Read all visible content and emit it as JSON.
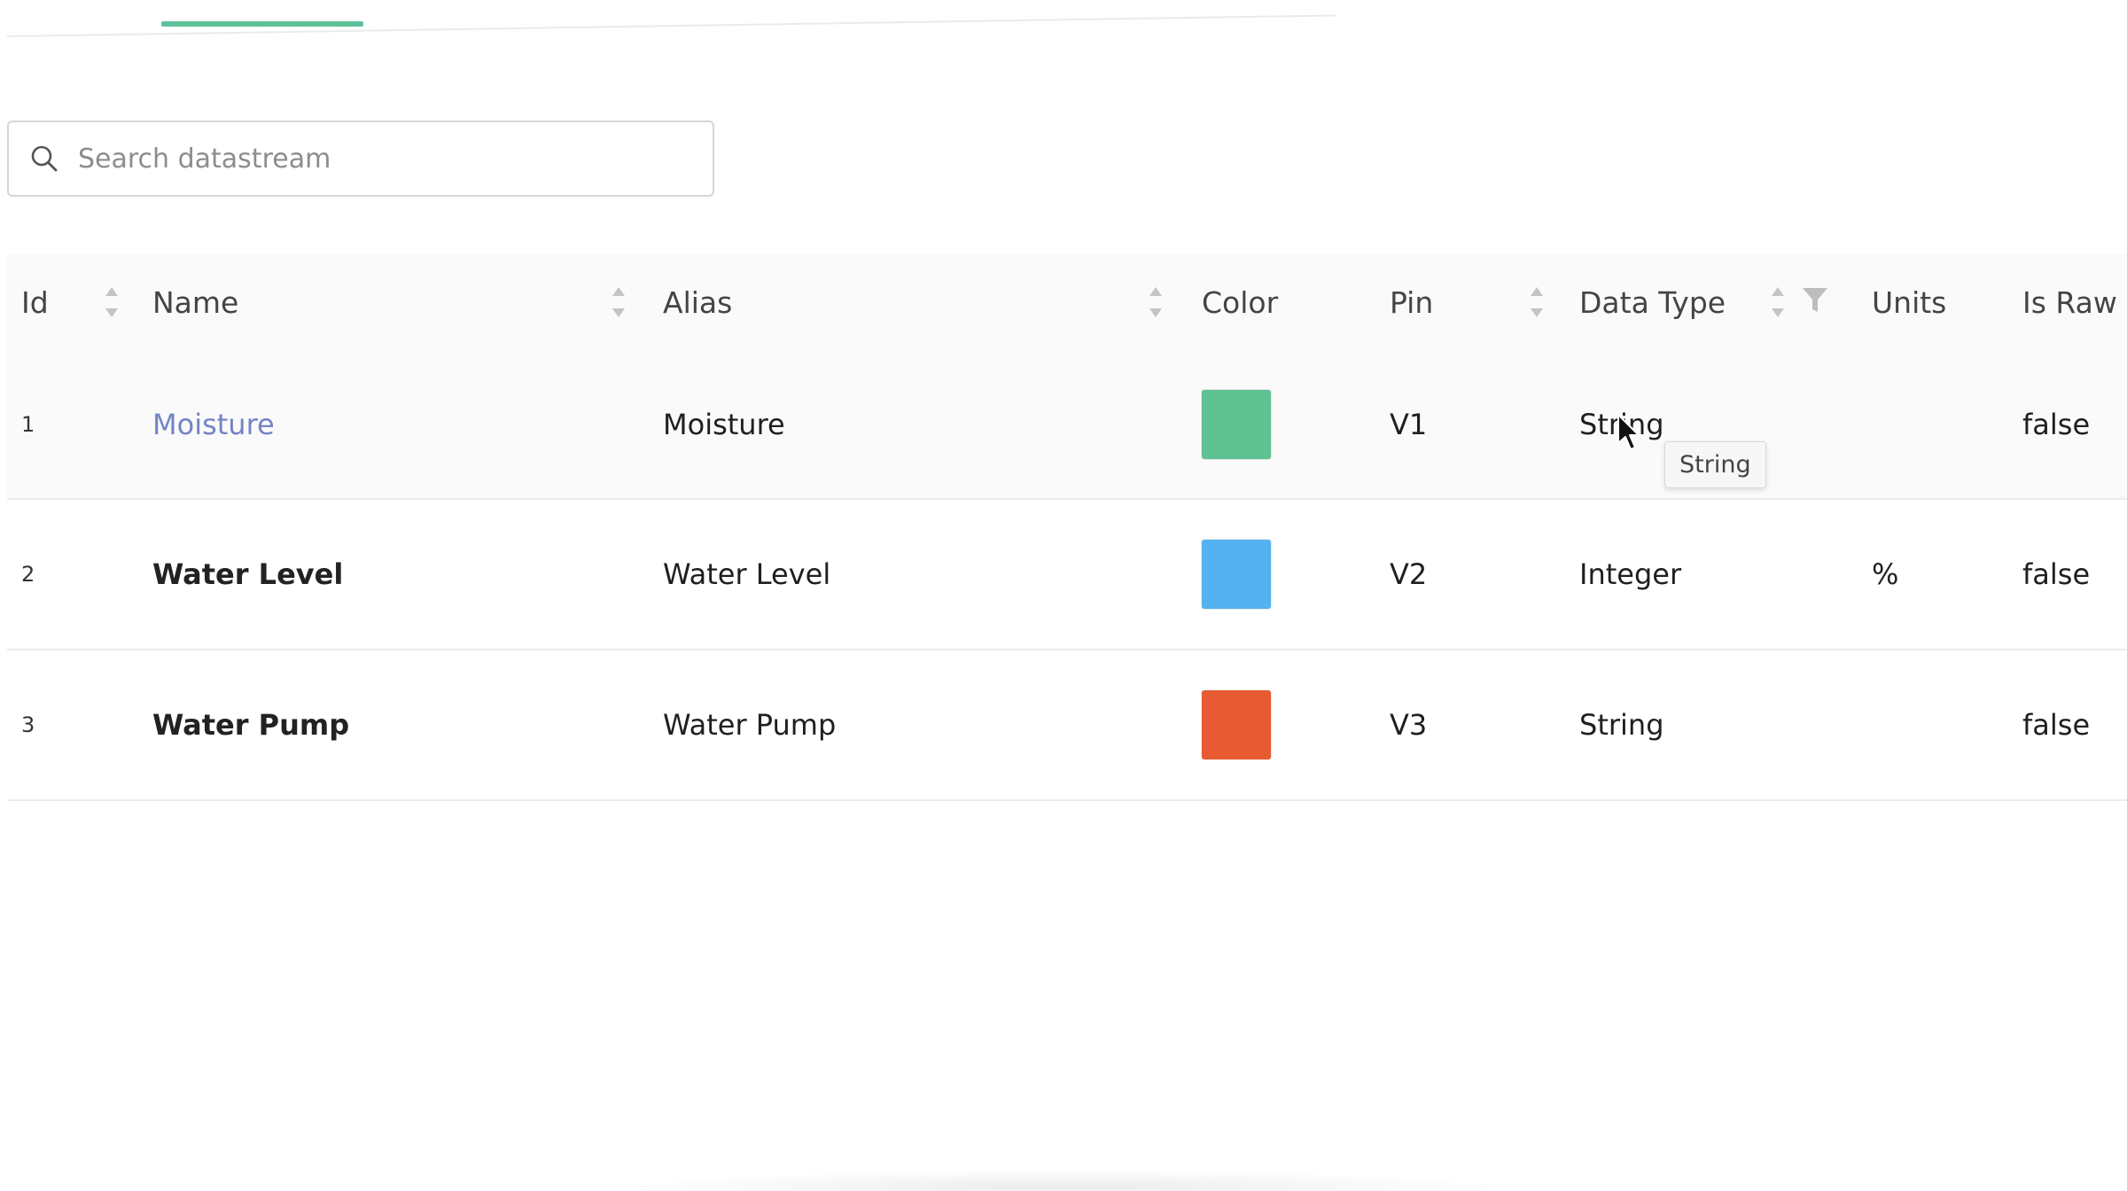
{
  "search": {
    "placeholder": "Search datastream"
  },
  "table": {
    "headers": {
      "id": "Id",
      "name": "Name",
      "alias": "Alias",
      "color": "Color",
      "pin": "Pin",
      "data_type": "Data Type",
      "units": "Units",
      "is_raw": "Is Raw"
    },
    "rows": [
      {
        "id": "1",
        "name": "Moisture",
        "alias": "Moisture",
        "color": "#5ec191",
        "pin": "V1",
        "data_type": "String",
        "units": "",
        "is_raw": "false"
      },
      {
        "id": "2",
        "name": "Water Level",
        "alias": "Water Level",
        "color": "#53b2ef",
        "pin": "V2",
        "data_type": "Integer",
        "units": "%",
        "is_raw": "false"
      },
      {
        "id": "3",
        "name": "Water Pump",
        "alias": "Water Pump",
        "color": "#e85b32",
        "pin": "V3",
        "data_type": "String",
        "units": "",
        "is_raw": "false"
      }
    ]
  },
  "tooltip": {
    "text": "String"
  },
  "colors": {
    "accent": "#5ec19a",
    "link": "#7384c6"
  }
}
